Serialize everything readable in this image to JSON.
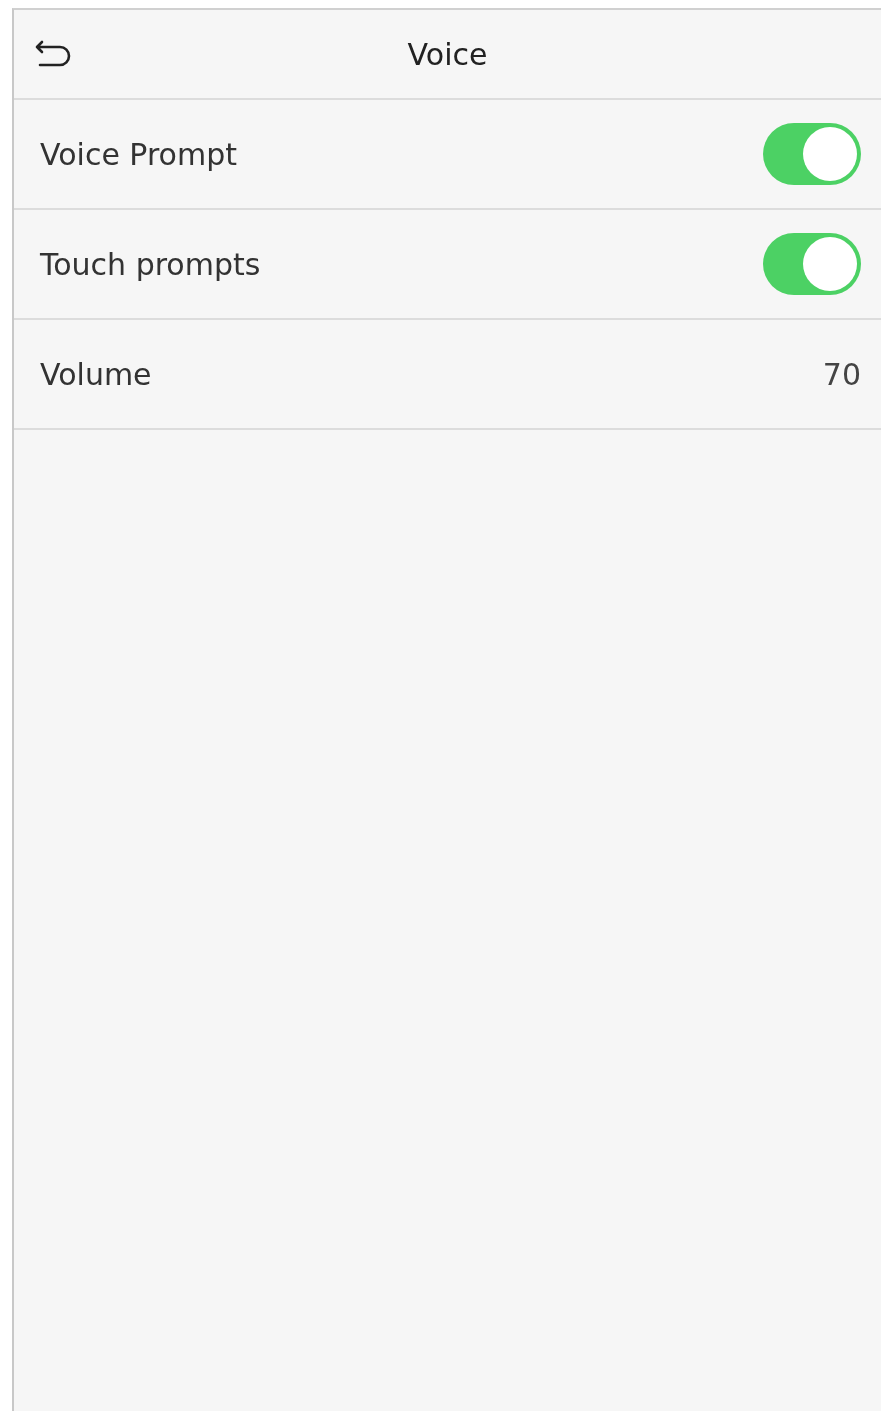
{
  "header": {
    "title": "Voice"
  },
  "rows": [
    {
      "kind": "toggle",
      "label": "Voice Prompt",
      "on": true
    },
    {
      "kind": "toggle",
      "label": "Touch prompts",
      "on": true
    },
    {
      "kind": "value",
      "label": "Volume",
      "value": "70"
    }
  ]
}
